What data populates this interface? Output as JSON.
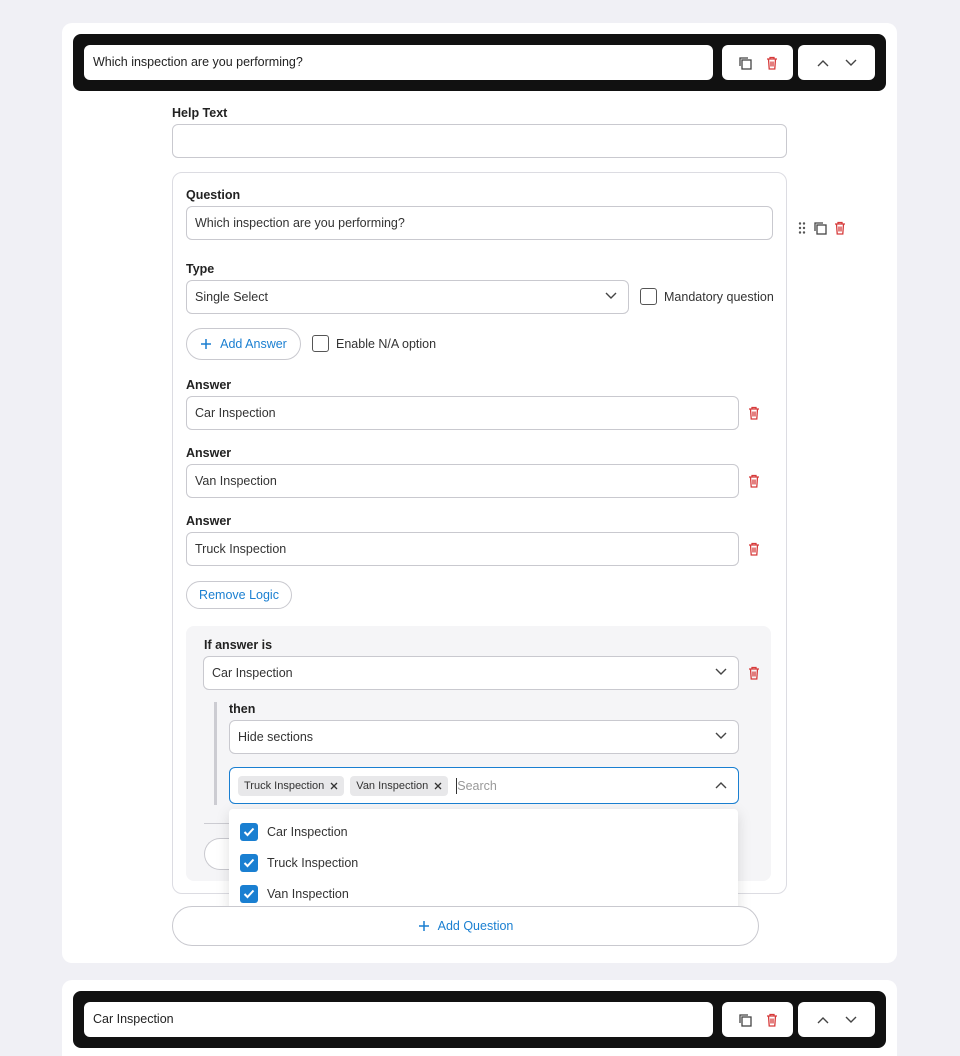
{
  "section1": {
    "title": "Which inspection are you performing?",
    "help_text_label": "Help Text",
    "help_text_value": "",
    "question": {
      "label": "Question",
      "value": "Which inspection are you performing?",
      "type_label": "Type",
      "type_value": "Single Select",
      "mandatory_label": "Mandatory question",
      "add_answer_label": "Add Answer",
      "enable_na_label": "Enable N/A option",
      "answers": [
        {
          "label": "Answer",
          "value": "Car Inspection"
        },
        {
          "label": "Answer",
          "value": "Van Inspection"
        },
        {
          "label": "Answer",
          "value": "Truck Inspection"
        }
      ],
      "remove_logic_label": "Remove Logic",
      "logic": {
        "if_label": "If answer is",
        "if_value": "Car Inspection",
        "then_label": "then",
        "then_value": "Hide sections",
        "chips": [
          "Truck Inspection",
          "Van Inspection"
        ],
        "search_placeholder": "Search",
        "options": [
          "Car Inspection",
          "Truck Inspection",
          "Van Inspection"
        ]
      }
    },
    "add_question_label": "Add Question"
  },
  "section2": {
    "title": "Car Inspection"
  },
  "colors": {
    "accent": "#1a7fd1",
    "danger": "#d63a3a",
    "bar": "#111111"
  }
}
